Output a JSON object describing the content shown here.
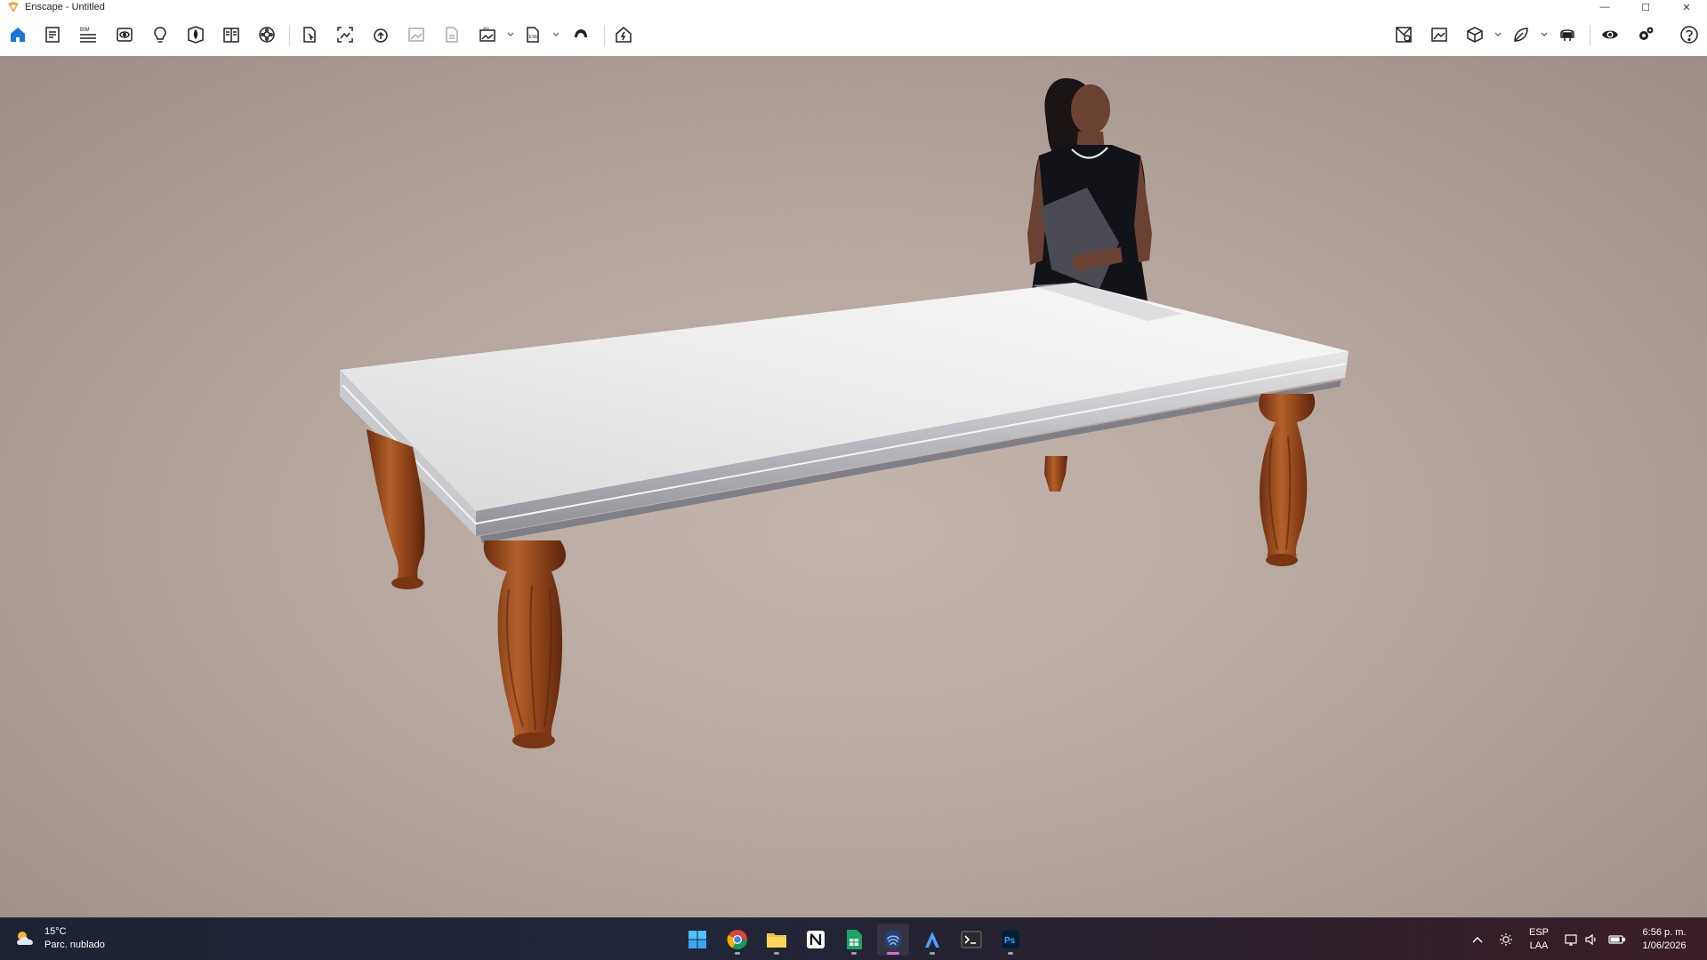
{
  "window": {
    "title": "Enscape - Untitled",
    "controls": {
      "minimize": "—",
      "maximize": "☐",
      "close": "✕"
    }
  },
  "toolbar": {
    "left_icons": [
      "home-icon",
      "project-info-icon",
      "bim-icon",
      "view-icon",
      "light-icon",
      "asset-icon",
      "materials-icon",
      "atmosphere-icon",
      "capture-icon",
      "screenshot-icon",
      "batch-icon",
      "image-icon",
      "document-icon",
      "panorama-icon",
      "export-icon",
      "cloud-icon",
      "upload-icon"
    ],
    "right_icons": [
      "minimap-icon",
      "visual-settings-icon",
      "cube-icon",
      "leaf-icon",
      "vr-icon",
      "eye-icon",
      "settings-icon",
      "help-icon"
    ],
    "bim_label": "BIM",
    "accent": "#1a73d8"
  },
  "taskbar": {
    "weather": {
      "temp": "15°C",
      "condition": "Parc. nublado"
    },
    "apps": [
      "windows-start-icon",
      "chrome-icon",
      "file-explorer-icon",
      "notion-icon",
      "sheets-icon",
      "enscape-icon",
      "revit-icon",
      "terminal-icon",
      "photoshop-icon"
    ],
    "tray": {
      "language": "ESP",
      "layout": "LAA",
      "time": "6:56 p. m.",
      "date": "1/06/2026"
    }
  }
}
